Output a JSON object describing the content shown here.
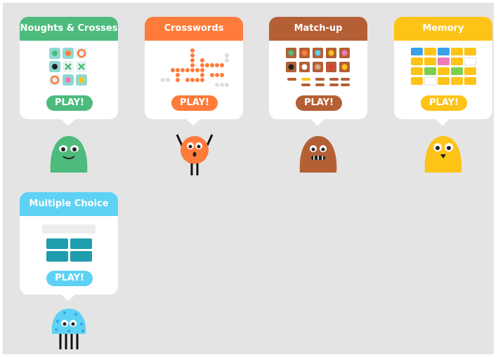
{
  "games": [
    {
      "title": "Noughts & Crosses",
      "play_label": "PLAY!",
      "color": "#4cbb7c",
      "mascot": "green-blob-mascot"
    },
    {
      "title": "Crosswords",
      "play_label": "PLAY!",
      "color": "#ff7b3b",
      "mascot": "orange-round-mascot"
    },
    {
      "title": "Match-up",
      "play_label": "PLAY!",
      "color": "#b45f36",
      "mascot": "brown-blob-mascot"
    },
    {
      "title": "Memory",
      "play_label": "PLAY!",
      "color": "#fdc316",
      "mascot": "yellow-blob-mascot"
    },
    {
      "title": "Multiple Choice",
      "play_label": "PLAY!",
      "color": "#5ed2f4",
      "mascot": "blue-fuzzy-mascot"
    }
  ],
  "background_color": "#e4e4e4"
}
